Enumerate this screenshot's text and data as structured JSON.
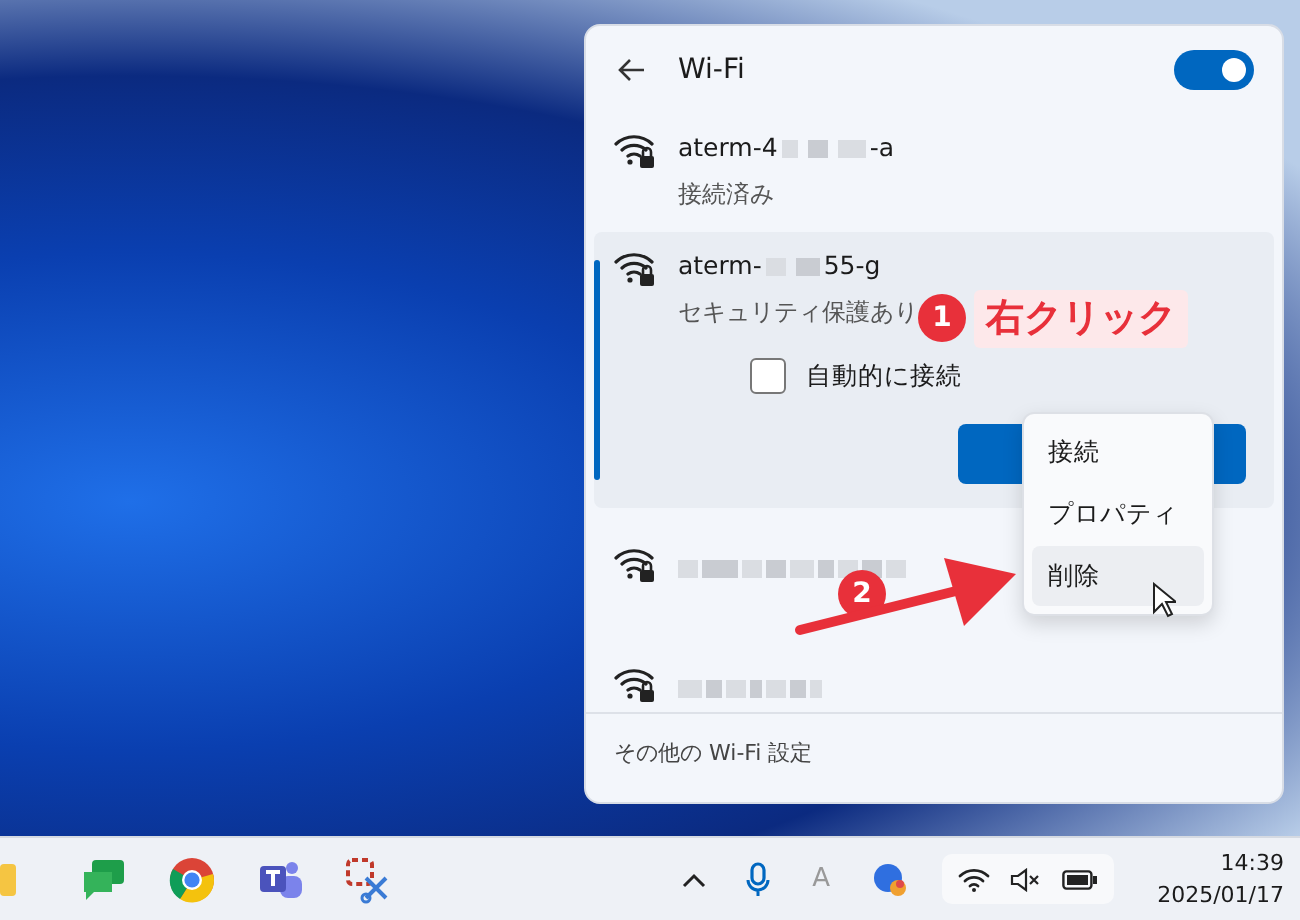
{
  "panel": {
    "title": "Wi-Fi",
    "wifi_on": true
  },
  "networks": [
    {
      "name_start": "aterm-4",
      "name_end": "-a",
      "status": "接続済み",
      "selected": false
    },
    {
      "name_start": "aterm-",
      "name_end": "55-g",
      "status": "セキュリティ保護あり",
      "selected": true,
      "auto_connect": {
        "label": "自動的に接続",
        "checked": false
      }
    },
    {
      "selected": false
    },
    {
      "selected": false
    }
  ],
  "context_menu": [
    {
      "label": "接続",
      "selected": false
    },
    {
      "label": "プロパティ",
      "selected": false
    },
    {
      "label": "削除",
      "selected": true
    }
  ],
  "annotations": {
    "step_1": {
      "badge": "1",
      "label": "右クリック"
    },
    "step_2": {
      "badge": "2"
    }
  },
  "footer": "その他の Wi-Fi 設定",
  "taskbar": {
    "input_indicator": "A",
    "time": "14:39",
    "date": "2025/01/17"
  }
}
